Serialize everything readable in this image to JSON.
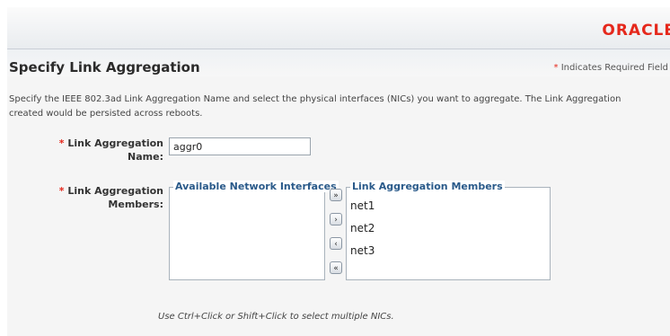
{
  "brand": "ORACLE",
  "page": {
    "title": "Specify Link Aggregation",
    "required_note": "Indicates Required Field",
    "required_marker": "*",
    "description": "Specify the IEEE 802.3ad Link Aggregation Name and select the physical interfaces (NICs) you want to aggregate. The Link Aggregation created would be persisted across reboots."
  },
  "form": {
    "name_label_line1": "Link Aggregation",
    "name_label_line2": "Name:",
    "name_value": "aggr0",
    "members_label_line1": "Link Aggregation",
    "members_label_line2": "Members:"
  },
  "shuttle": {
    "available_title": "Available Network Interfaces",
    "available_items": [],
    "members_title": "Link Aggregation Members",
    "members_items": [
      "net1",
      "net2",
      "net3"
    ],
    "buttons": {
      "move_all": "»",
      "move": "›",
      "remove": "‹",
      "remove_all": "«"
    }
  },
  "hint": "Use Ctrl+Click or Shift+Click to select multiple NICs.",
  "colors": {
    "brand": "#e5281c",
    "required": "#e5281c",
    "list_title": "#2a5a8a"
  }
}
